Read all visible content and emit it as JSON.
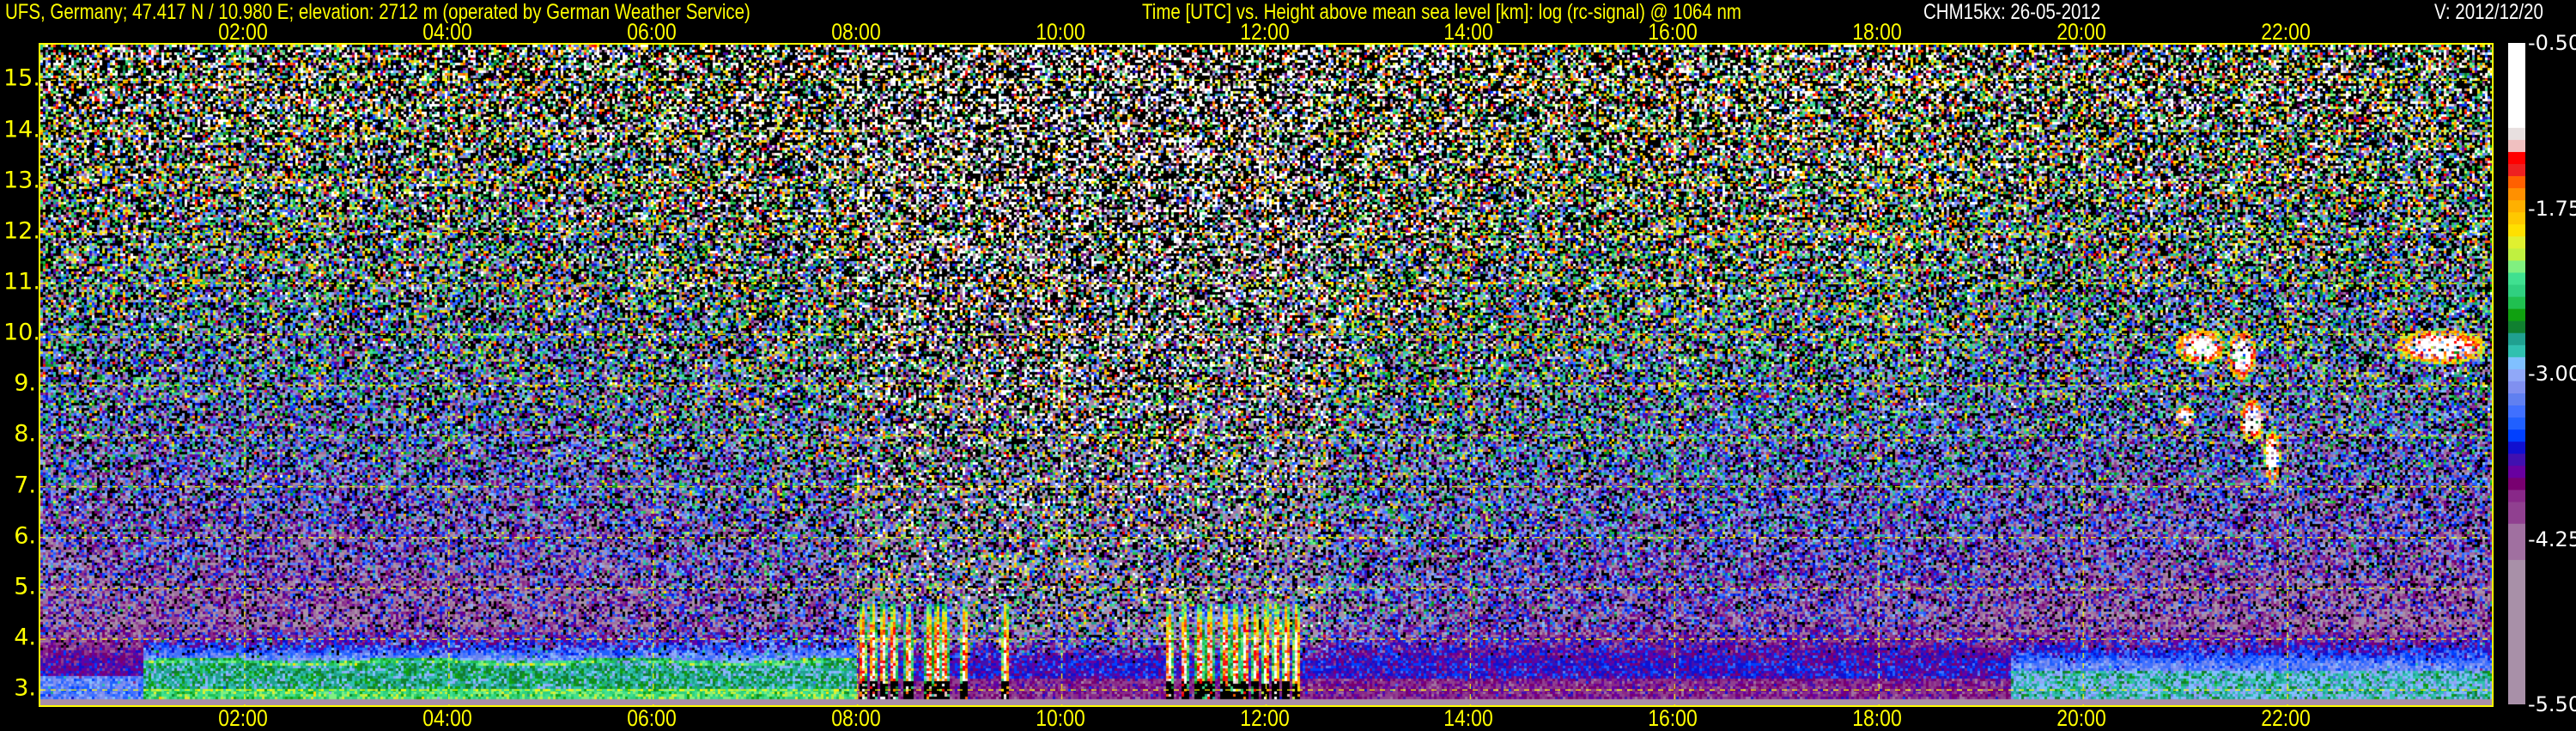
{
  "header": {
    "station": "UFS, Germany; 47.417 N / 10.980 E; elevation: 2712 m  (operated by German Weather Service)",
    "description": "Time [UTC] vs. Height above mean sea level [km]: log (rc-signal) @ 1064 nm",
    "instrument": "CHM15kx: 26-05-2012",
    "version": "V: 2012/12/20"
  },
  "chart_data": {
    "type": "heatmap",
    "title": "Time [UTC] vs. Height above mean sea level [km]: log (rc-signal) @ 1064 nm",
    "xlabel": "Time [UTC]",
    "ylabel": "Height above mean sea level [km]",
    "xlim": [
      0,
      24
    ],
    "ylim": [
      2.7,
      15.7
    ],
    "x_ticks": [
      2,
      4,
      6,
      8,
      10,
      12,
      14,
      16,
      18,
      20,
      22
    ],
    "x_tick_labels": [
      "02:00",
      "04:00",
      "06:00",
      "08:00",
      "10:00",
      "12:00",
      "14:00",
      "16:00",
      "18:00",
      "20:00",
      "22:00"
    ],
    "y_ticks": [
      3,
      4,
      5,
      6,
      7,
      8,
      9,
      10,
      11,
      12,
      13,
      14,
      15
    ],
    "y_tick_labels": [
      "3.",
      "4.",
      "5.",
      "6.",
      "7.",
      "8.",
      "9.",
      "10.",
      "11.",
      "12.",
      "13.",
      "14.",
      "15."
    ],
    "grid": true,
    "colorbar": {
      "range": [
        -5.5,
        -0.5
      ],
      "tick_labels": [
        "-0.50",
        "-1.75",
        "-3.00",
        "-4.25",
        "-5.50"
      ],
      "tick_values": [
        -0.5,
        -1.75,
        -3.0,
        -4.25,
        -5.5
      ],
      "colors": [
        "#a890a8",
        "#a070a0",
        "#904090",
        "#882888",
        "#780070",
        "#6800a0",
        "#4010b0",
        "#1010d0",
        "#0040ff",
        "#2060ff",
        "#4070ff",
        "#6080f0",
        "#8090f0",
        "#90a8f8",
        "#80c0ff",
        "#30c0b0",
        "#20a090",
        "#108030",
        "#10a010",
        "#20c050",
        "#30d080",
        "#40e090",
        "#80f080",
        "#c0f040",
        "#e0f030",
        "#ffe000",
        "#ffc800",
        "#ffb000",
        "#ff9000",
        "#ff6000",
        "#ee2020",
        "#ff0000",
        "#f0c0c0",
        "#e8e0e0",
        "#ffffff"
      ]
    },
    "features": [
      {
        "name": "convective-cells",
        "time_range": [
          8.0,
          9.2
        ],
        "height_range": [
          2.8,
          4.6
        ]
      },
      {
        "name": "convective-cells",
        "time_range": [
          11.0,
          12.5
        ],
        "height_range": [
          2.8,
          4.6
        ]
      },
      {
        "name": "cirrus-cloud",
        "time_range": [
          21.0,
          22.0
        ],
        "height_range": [
          7.0,
          10.2
        ]
      },
      {
        "name": "cirrus-cloud",
        "time_range": [
          23.0,
          24.0
        ],
        "height_range": [
          9.0,
          10.2
        ]
      }
    ]
  }
}
